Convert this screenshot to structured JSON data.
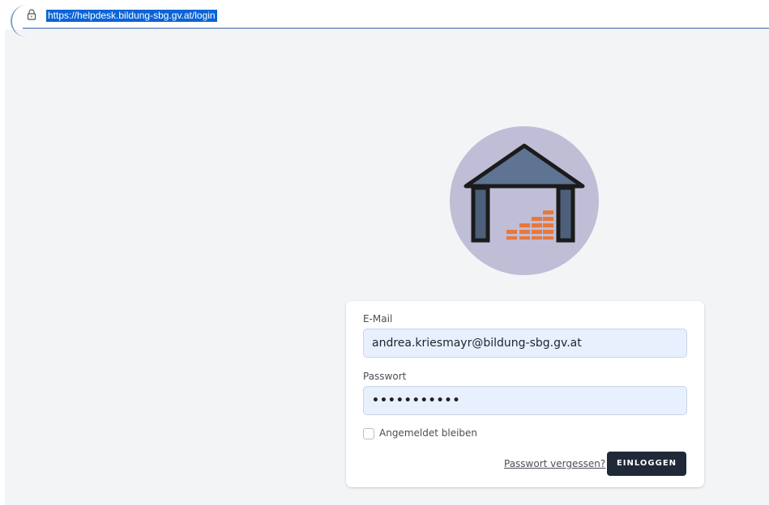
{
  "browser": {
    "url": "https://helpdesk.bildung-sbg.gv.at/login"
  },
  "form": {
    "email_label": "E-Mail",
    "email_value": "andrea.kriesmayr@bildung-sbg.gv.at",
    "password_label": "Passwort",
    "password_value": "•••••••••••",
    "remember_label": "Angemeldet bleiben",
    "remember_checked": false,
    "forgot_link": "Passwort vergessen?",
    "login_button": "EINLOGGEN"
  },
  "colors": {
    "logo_circle": "#c0bdd6",
    "logo_roof": "#5f7393",
    "logo_bricks": "#e8783a",
    "button": "#1f2937",
    "input_bg": "#e8f0fd"
  },
  "icons": {
    "lock": "lock-icon",
    "logo": "house-logo"
  }
}
